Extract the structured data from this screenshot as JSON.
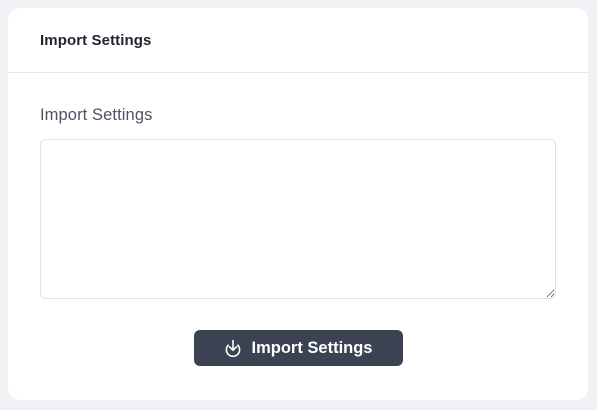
{
  "card": {
    "title": "Import Settings"
  },
  "form": {
    "field_label": "Import Settings",
    "textarea_value": ""
  },
  "actions": {
    "import_button_label": "Import Settings",
    "import_button_icon": "download-icon"
  },
  "colors": {
    "page_background": "#f0f1f5",
    "card_background": "#ffffff",
    "button_background": "#3b4252",
    "button_text": "#ffffff"
  }
}
